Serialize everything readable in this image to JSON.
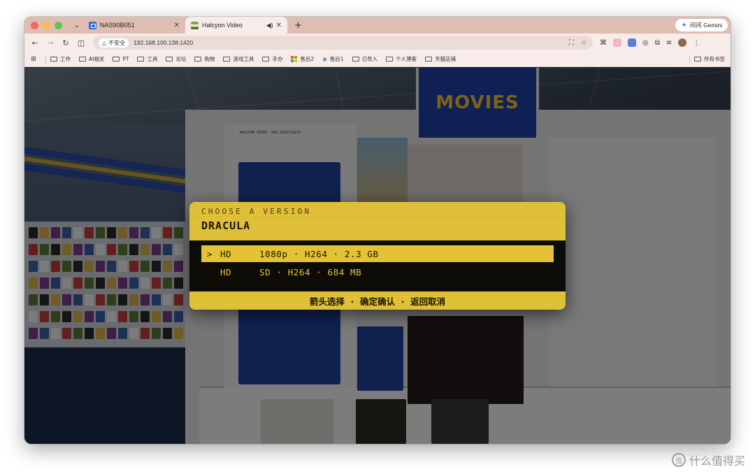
{
  "browser": {
    "tabs": [
      {
        "title": "NAS90B051",
        "active": false
      },
      {
        "title": "Halcyon Video",
        "active": true
      }
    ],
    "gemini_label": "问问 Gemini",
    "insecure_label": "不安全",
    "url": "192.168.100.138:1420",
    "bookmarks": [
      "工作",
      "AI相关",
      "PT",
      "工具",
      "论坛",
      "购物",
      "游戏工具",
      "手办",
      "售后2",
      "售后1",
      "已导入",
      "个人博客",
      "天猫店铺"
    ],
    "all_bookmarks_label": "所有书签"
  },
  "scene": {
    "sign_text": "MOVIES",
    "box_label_line1": "HALCYON VIDEO",
    "box_label_line2": "390.3625719215"
  },
  "dialog": {
    "subtitle": "CHOOSE A VERSION",
    "title": "DRACULA",
    "options": [
      {
        "cursor": ">",
        "format": "HD",
        "details": "1080p · H264 · 2.3 GB",
        "selected": true
      },
      {
        "cursor": "",
        "format": "HD",
        "details": "SD · H264 · 684 MB",
        "selected": false
      }
    ],
    "footer": "箭头选择  ·  确定确认  ·  返回取消"
  },
  "watermark": {
    "icon": "值",
    "text": "什么值得买"
  },
  "colors": {
    "accent_yellow": "#e3c235",
    "panel_dark": "#0d0b06",
    "sign_blue": "#1b3fa7"
  }
}
